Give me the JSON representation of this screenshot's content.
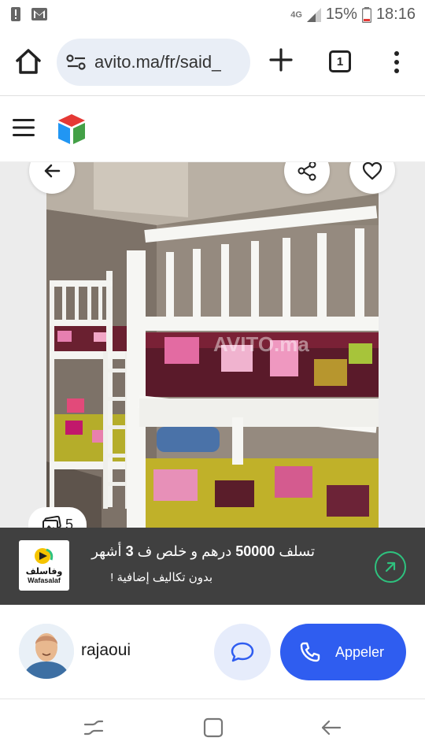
{
  "status_bar": {
    "network": "4G",
    "battery": "15%",
    "time": "18:16"
  },
  "browser": {
    "url": "avito.ma/fr/said_",
    "tab_count": "1"
  },
  "listing": {
    "photo_count": "5",
    "watermark": "AVITO.ma"
  },
  "ad": {
    "brand_ar": "وفاسلف",
    "brand_en": "Wafasalaf",
    "line1_part1": "تسلف ",
    "line1_amount": "50000",
    "line1_part2": " درهم و خلص ف ",
    "line1_months": "3",
    "line1_part3": " أشهر",
    "line2": "بدون تكاليف إضافية !",
    "accent_color": "#2ec27e"
  },
  "seller": {
    "name": "rajaoui",
    "call_label": "Appeler"
  },
  "colors": {
    "primary": "#2f5df0",
    "ad_background": "#404040"
  }
}
